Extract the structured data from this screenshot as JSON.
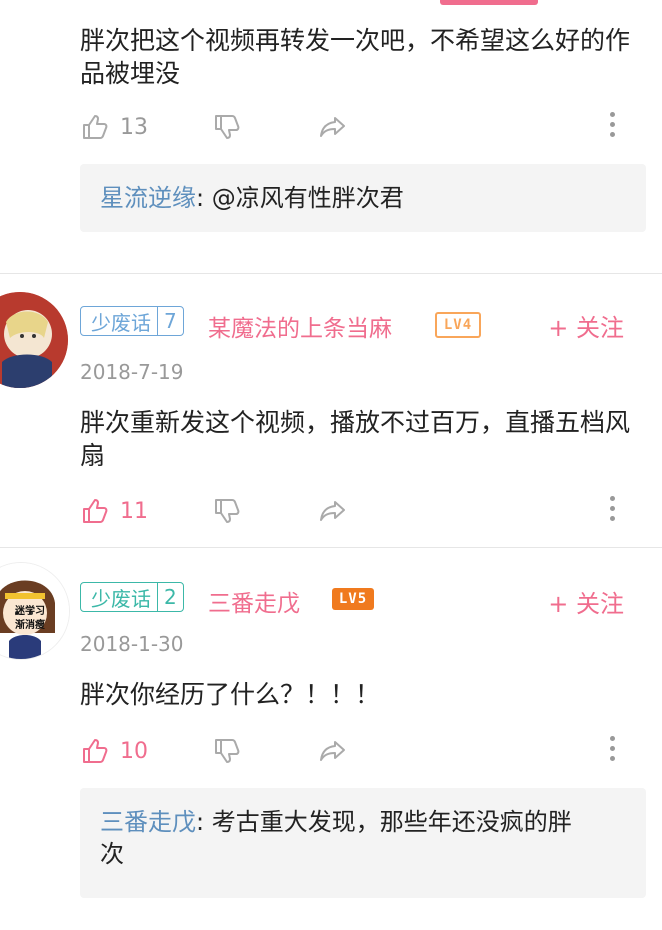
{
  "comments": [
    {
      "text": "胖次把这个视频再转发一次吧，不希望这么好的作品被埋没",
      "likes": "13",
      "reply": {
        "name": "星流逆缘",
        "text": ": @凉风有性胖次君"
      }
    },
    {
      "badge_label": "少废话",
      "badge_num": "7",
      "username": "某魔法的上条当麻",
      "level": "LV4",
      "follow": "+ 关注",
      "date": "2018-7-19",
      "text": "胖次重新发这个视频，播放不过百万，直播五档风扇",
      "likes": "11"
    },
    {
      "badge_label": "少废话",
      "badge_num": "2",
      "username": "三番走戊",
      "level": "LV5",
      "follow": "+ 关注",
      "date": "2018-1-30",
      "text": "胖次你经历了什么？！！！",
      "likes": "10",
      "avatar_text": "迷学习\n渐消瘦",
      "reply": {
        "name": "三番走戊",
        "text": ": 考古重大发现，那些年还没疯的胖次"
      }
    }
  ],
  "colors": {
    "accent": "#f06d8e",
    "reply_name": "#5e8fbd",
    "lv4": "#f9a65a",
    "lv5": "#f07a1e",
    "badge_blue": "#6ea6d8",
    "badge_teal": "#3cb8a8"
  }
}
